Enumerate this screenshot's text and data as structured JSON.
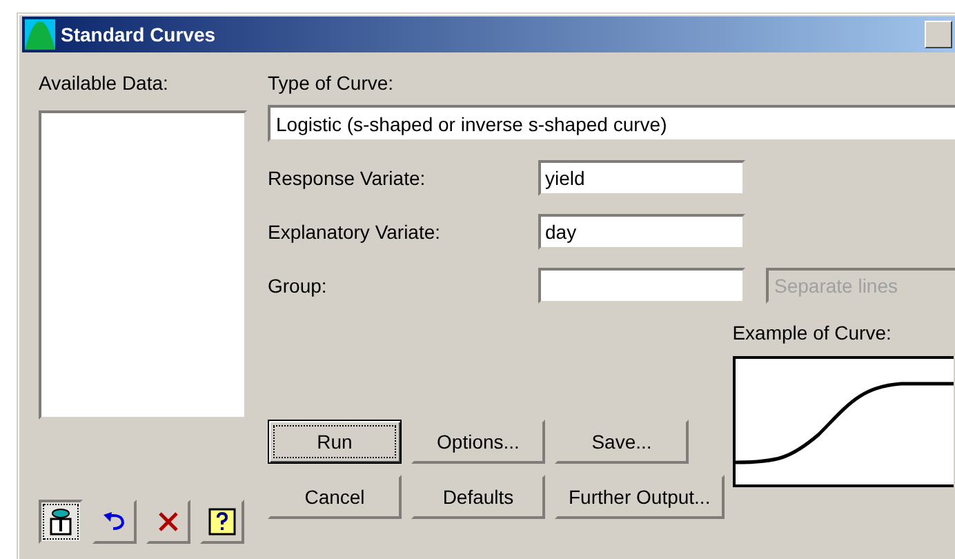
{
  "window": {
    "title": "Standard Curves"
  },
  "available_data": {
    "label": "Available Data:"
  },
  "curve_type": {
    "label": "Type of Curve:",
    "value": "Logistic (s-shaped or inverse s-shaped curve)"
  },
  "fields": [
    {
      "label": "Response Variate:",
      "value": "yield"
    },
    {
      "label": "Explanatory Variate:",
      "value": "day"
    },
    {
      "label": "Group:",
      "option": {
        "value": "Separate lines",
        "disabled": true
      }
    }
  ],
  "example": {
    "label": "Example of Curve:"
  },
  "tools": [
    {
      "kind": "pin",
      "selected": true
    },
    {
      "kind": "undo",
      "selected": false
    },
    {
      "kind": "delete",
      "selected": false
    },
    {
      "kind": "help",
      "selected": false
    }
  ],
  "buttons": [
    [
      {
        "label": "Run",
        "default": true
      },
      {
        "label": "Options...",
        "default": false
      },
      {
        "label": "Save...",
        "default": false
      }
    ],
    [
      {
        "label": "Cancel",
        "default": false
      },
      {
        "label": "Defaults",
        "default": false
      },
      {
        "label": "Further Output...",
        "default": false
      }
    ]
  ]
}
